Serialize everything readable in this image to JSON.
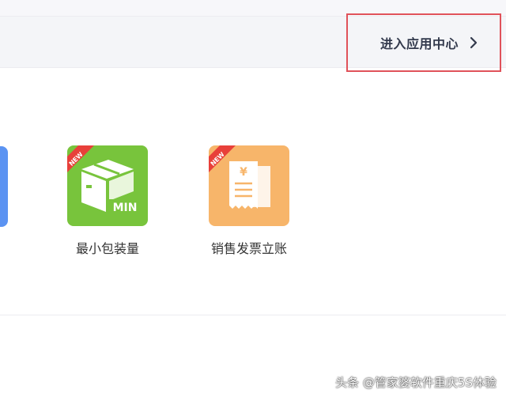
{
  "header": {
    "app_center_label": "进入应用中心",
    "chevron_icon": "chevron-right-icon"
  },
  "apps": [
    {
      "label": "最小包装量",
      "icon": "min-box-icon",
      "icon_text": "MIN",
      "badge": "NEW",
      "color": "#78c43c"
    },
    {
      "label": "销售发票立账",
      "icon": "invoice-receipt-icon",
      "icon_text": "¥",
      "badge": "NEW",
      "color": "#f7b56a"
    }
  ],
  "watermark": "头条 @管家婆软件重庆5S体验",
  "colors": {
    "highlight_border": "#e0525a",
    "partial_tile": "#5b93f2",
    "ribbon": "#e8403a"
  }
}
